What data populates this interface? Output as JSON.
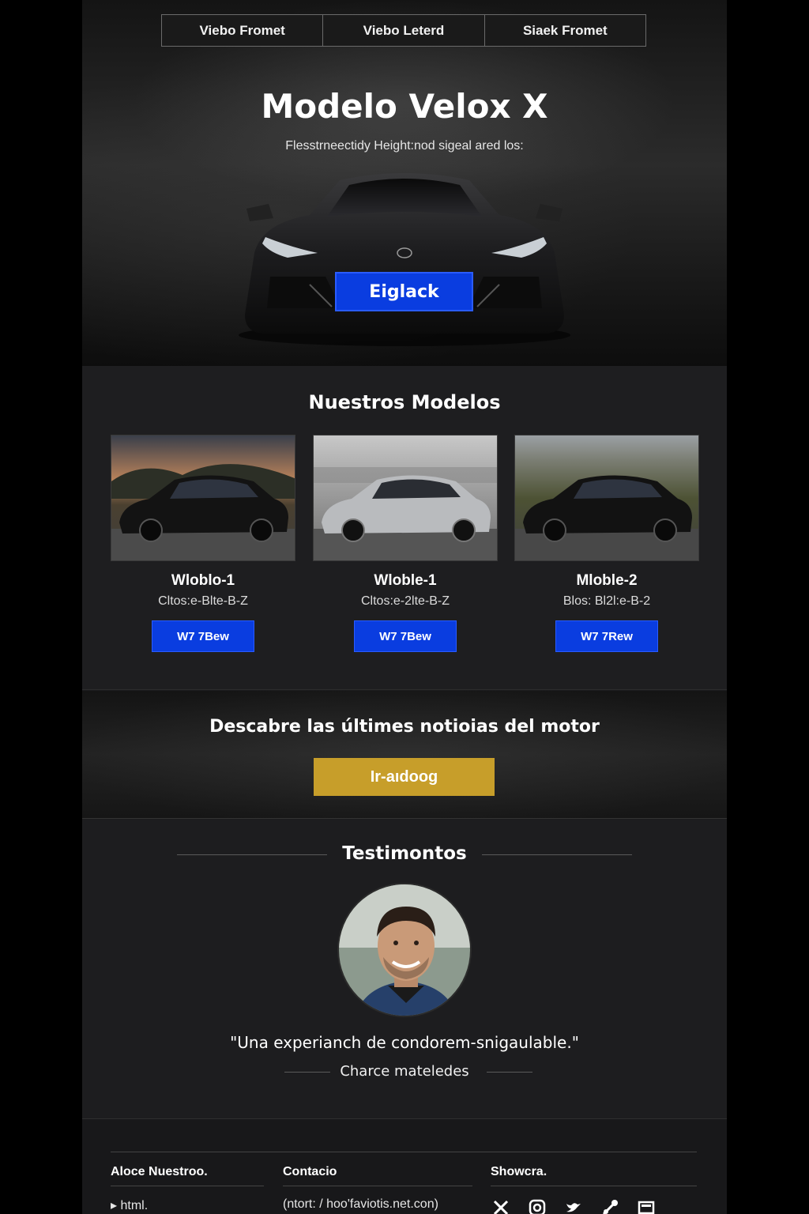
{
  "nav": {
    "items": [
      "Viebo Fromet",
      "Viebo Leterd",
      "Siaek Fromet"
    ]
  },
  "hero": {
    "title": "Modelo Velox X",
    "subtitle": "Flesstrneectidy Height:nod sigeal ared los:",
    "cta_label": "Eiglack"
  },
  "models": {
    "title": "Nuestros Modelos",
    "items": [
      {
        "name": "Wloblo-1",
        "spec": "Cltos:e-Blte-B-Z",
        "button": "W7 7Bew",
        "paint": "black",
        "scene": "sunset"
      },
      {
        "name": "Wloble-1",
        "spec": "Cltos:e-2lte-B-Z",
        "button": "W7 7Bew",
        "paint": "silver",
        "scene": "city"
      },
      {
        "name": "Mloble-2",
        "spec": "Blos: Bl2l:e-B-2",
        "button": "W7 7Rew",
        "paint": "black",
        "scene": "field"
      }
    ]
  },
  "news": {
    "title": "Descabre las últimes notioias del motor",
    "button": "Ir-aıdoog",
    "button_color": "#c79e2a"
  },
  "testimonials": {
    "title": "Testimontos",
    "quote": "\"Una experianch de condorem-snigaulable.\"",
    "author": "Charce mateledes"
  },
  "footer": {
    "col1": {
      "heading": "Aloce Nuestroo.",
      "text": "▸ html."
    },
    "col2": {
      "heading": "Contacio",
      "text": "(ntort: / hoo'faviotis.net.con)"
    },
    "col3": {
      "heading": "Showcra.",
      "icons": [
        "x-icon",
        "instagram-icon",
        "bird-icon",
        "share-icon",
        "screen-icon"
      ]
    }
  },
  "colors": {
    "accent_blue": "#0a3de0",
    "gold": "#c79e2a",
    "page_bg": "#1c1c1e"
  }
}
